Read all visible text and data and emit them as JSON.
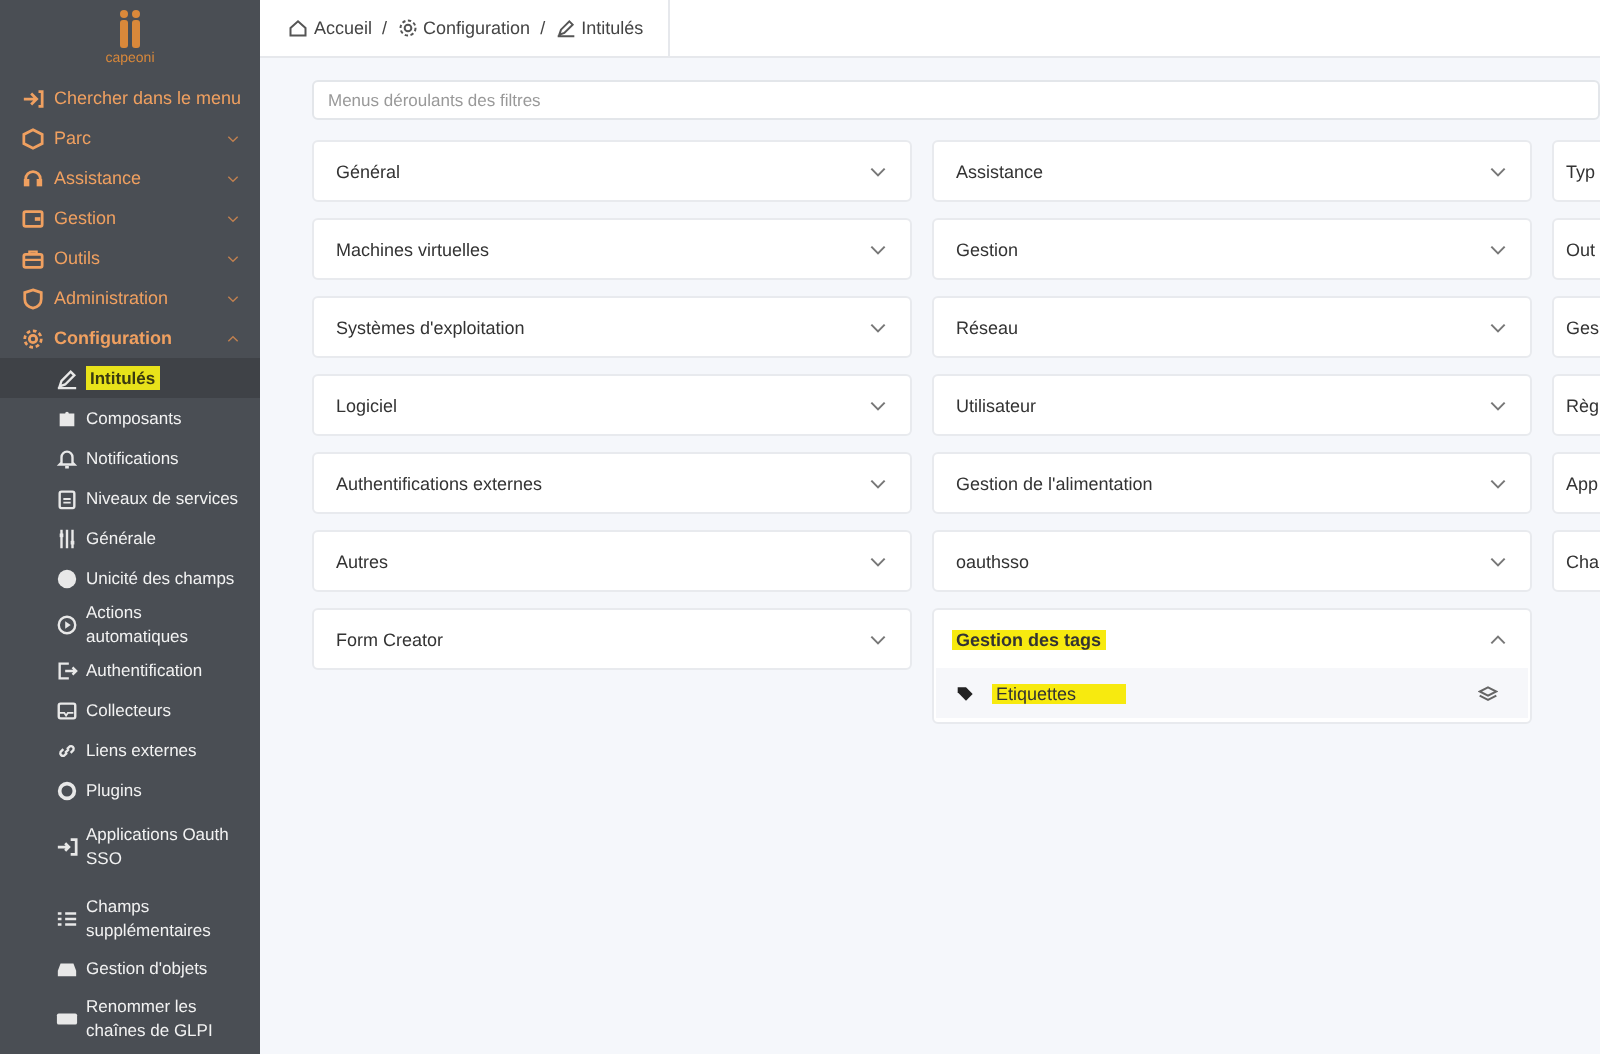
{
  "sidebar": {
    "logo_text": "capeoni",
    "items": [
      {
        "label": "Chercher dans le menu",
        "expanded": false
      },
      {
        "label": "Parc",
        "expandable": true,
        "expanded": false
      },
      {
        "label": "Assistance",
        "expandable": true,
        "expanded": false
      },
      {
        "label": "Gestion",
        "expandable": true,
        "expanded": false
      },
      {
        "label": "Outils",
        "expandable": true,
        "expanded": false
      },
      {
        "label": "Administration",
        "expandable": true,
        "expanded": false
      },
      {
        "label": "Configuration",
        "expandable": true,
        "expanded": true,
        "children": [
          {
            "label": "Intitulés",
            "selected": true,
            "highlighted": true
          },
          {
            "label": "Composants",
            "selected": false,
            "highlighted": false
          },
          {
            "label": "Notifications",
            "selected": false,
            "highlighted": false
          },
          {
            "label": "Niveaux de services",
            "selected": false,
            "highlighted": false
          },
          {
            "label": "Générale",
            "selected": false,
            "highlighted": false
          },
          {
            "label": "Unicité des champs",
            "selected": false,
            "highlighted": false
          },
          {
            "label": "Actions automatiques",
            "selected": false,
            "highlighted": false
          },
          {
            "label": "Authentification",
            "selected": false,
            "highlighted": false
          },
          {
            "label": "Collecteurs",
            "selected": false,
            "highlighted": false
          },
          {
            "label": "Liens externes",
            "selected": false,
            "highlighted": false
          },
          {
            "label": "Plugins",
            "selected": false,
            "highlighted": false
          },
          {
            "label": "Applications Oauth SSO",
            "selected": false,
            "highlighted": false
          },
          {
            "label": "Champs supplémentaires",
            "selected": false,
            "highlighted": false
          },
          {
            "label": "Gestion d'objets",
            "selected": false,
            "highlighted": false
          },
          {
            "label": "Renommer les chaînes de GLPI",
            "selected": false,
            "highlighted": false
          }
        ]
      }
    ]
  },
  "breadcrumb": {
    "separator": "/",
    "items": [
      "Accueil",
      "Configuration",
      "Intitulés"
    ]
  },
  "filter": {
    "placeholder": "Menus déroulants des filtres"
  },
  "columns": [
    [
      {
        "label": "Général",
        "expanded": false,
        "highlighted": false
      },
      {
        "label": "Machines virtuelles",
        "expanded": false,
        "highlighted": false
      },
      {
        "label": "Systèmes d'exploitation",
        "expanded": false,
        "highlighted": false
      },
      {
        "label": "Logiciel",
        "expanded": false,
        "highlighted": false
      },
      {
        "label": "Authentifications externes",
        "expanded": false,
        "highlighted": false
      },
      {
        "label": "Autres",
        "expanded": false,
        "highlighted": false
      },
      {
        "label": "Form Creator",
        "expanded": false,
        "highlighted": false
      }
    ],
    [
      {
        "label": "Assistance",
        "expanded": false,
        "highlighted": false
      },
      {
        "label": "Gestion",
        "expanded": false,
        "highlighted": false
      },
      {
        "label": "Réseau",
        "expanded": false,
        "highlighted": false
      },
      {
        "label": "Utilisateur",
        "expanded": false,
        "highlighted": false
      },
      {
        "label": "Gestion de l'alimentation",
        "expanded": false,
        "highlighted": false
      },
      {
        "label": "oauthsso",
        "expanded": false,
        "highlighted": false
      },
      {
        "label": "Gestion des tags",
        "expanded": true,
        "highlighted": true,
        "items": [
          {
            "label": "Etiquettes",
            "highlighted": true
          }
        ]
      }
    ],
    [
      {
        "label": "Typ",
        "expanded": false,
        "highlighted": false
      },
      {
        "label": "Out",
        "expanded": false,
        "highlighted": false
      },
      {
        "label": "Ges",
        "expanded": false,
        "highlighted": false
      },
      {
        "label": "Règ",
        "expanded": false,
        "highlighted": false
      },
      {
        "label": "App",
        "expanded": false,
        "highlighted": false
      },
      {
        "label": "Cha",
        "expanded": false,
        "highlighted": false
      }
    ]
  ]
}
